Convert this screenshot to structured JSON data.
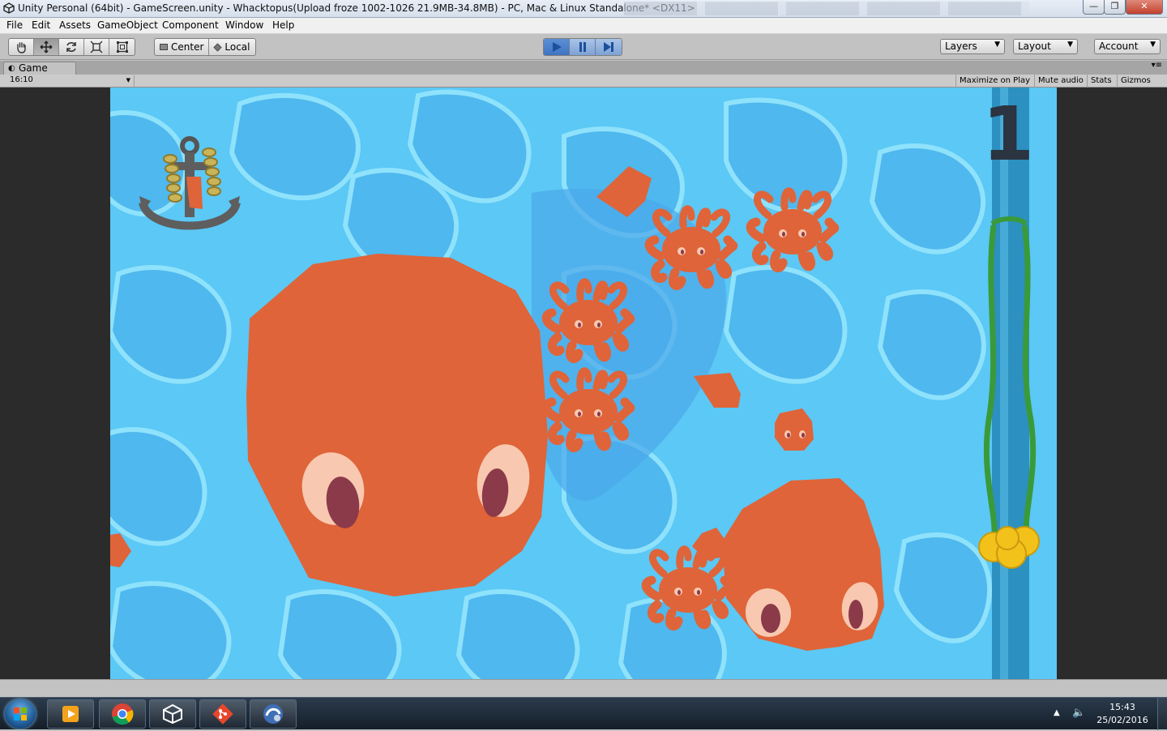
{
  "window": {
    "title": "Unity Personal (64bit) - GameScreen.unity - Whacktopus(Upload froze 1002-1026 21.9MB-34.8MB) - PC, Mac & Linux Standalone* <DX11>",
    "min_glyph": "—",
    "max_glyph": "❐",
    "close_glyph": "✕"
  },
  "menu": [
    "File",
    "Edit",
    "Assets",
    "GameObject",
    "Component",
    "Window",
    "Help"
  ],
  "toolbar": {
    "pivot_label": "Center",
    "space_label": "Local",
    "layers_label": "Layers",
    "layout_label": "Layout",
    "account_label": "Account"
  },
  "game_tab": {
    "label": "Game",
    "aspect": "16:10",
    "maximize_on_play": "Maximize on Play",
    "mute_audio": "Mute audio",
    "stats": "Stats",
    "gizmos": "Gizmos"
  },
  "game": {
    "score": "1",
    "colors": {
      "water": "#5bc8f5",
      "octopus": "#df6439",
      "eye_white": "#f8c8b0",
      "pupil": "#8b3a4a",
      "meter": "#2c90c0"
    }
  },
  "taskbar": {
    "time": "15:43",
    "date": "25/02/2016",
    "apps": [
      "media-player-icon",
      "chrome-icon",
      "unity-icon",
      "git-icon",
      "remote-desktop-icon"
    ]
  }
}
